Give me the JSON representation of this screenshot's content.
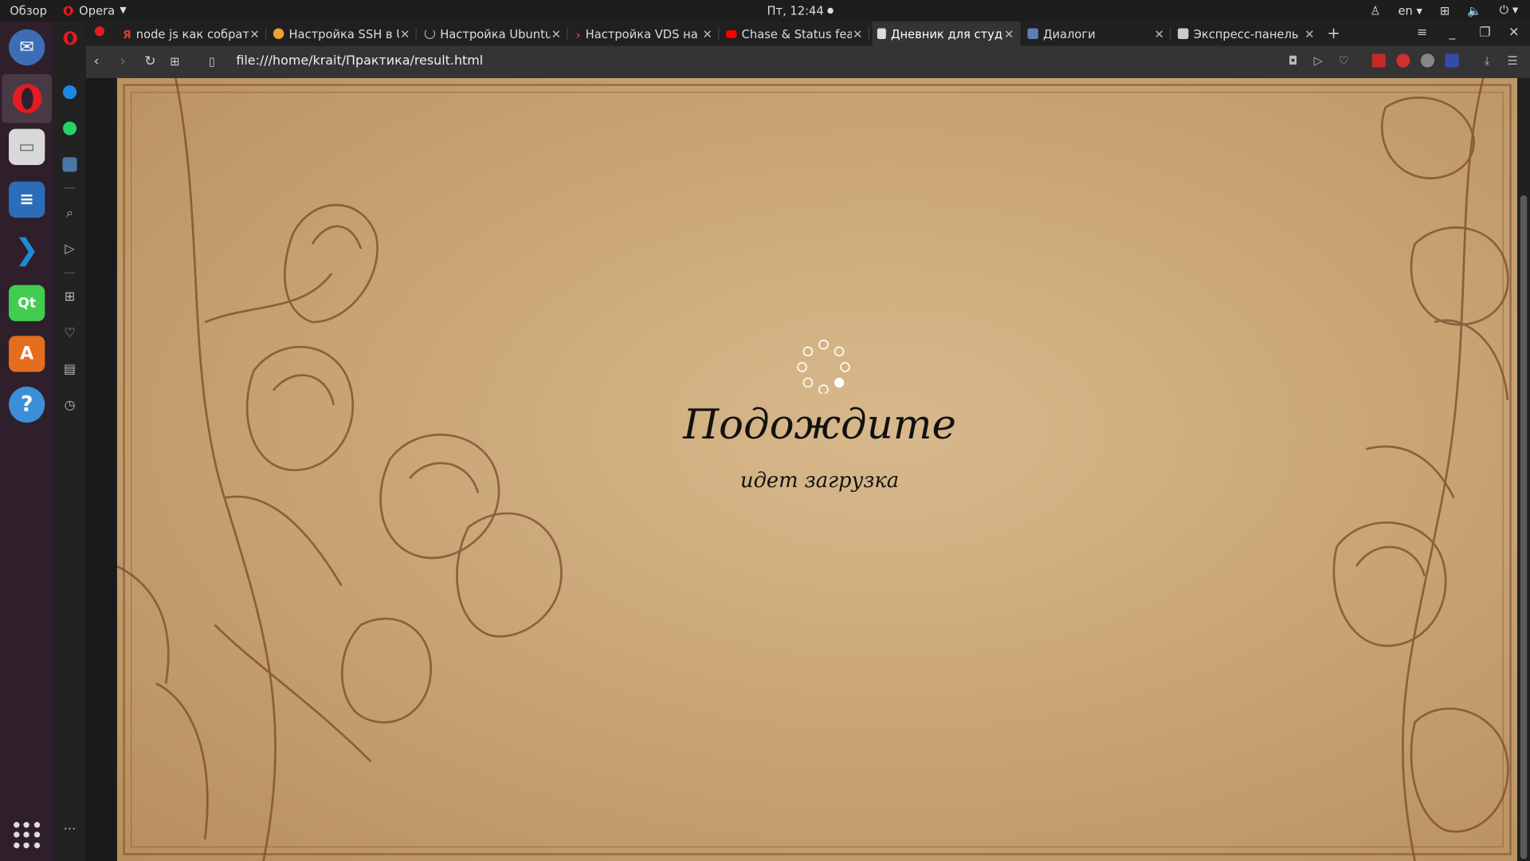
{
  "system": {
    "overview": "Обзор",
    "app_name": "Opera",
    "clock": "Пт, 12:44",
    "lang": "en"
  },
  "tabs": [
    {
      "title": "node js как собрать",
      "color": "#e53935"
    },
    {
      "title": "Настройка SSH в Ubuntu",
      "color": "#f0a030"
    },
    {
      "title": "Настройка Ubuntu",
      "color": "#888888"
    },
    {
      "title": "Настройка VDS на",
      "color": "#e53935"
    },
    {
      "title": "Chase & Status feat",
      "color": "#ff0000"
    },
    {
      "title": "Дневник для студента",
      "color": "#dddddd"
    },
    {
      "title": "Диалоги",
      "color": "#5b7db8"
    },
    {
      "title": "Экспресс-панель",
      "color": "#cccccc"
    }
  ],
  "address": {
    "url": "file:///home/krait/Практика/result.html"
  },
  "page": {
    "title": "Подождите",
    "subtitle": "идет загрузка"
  },
  "colors": {
    "opera_red": "#e31b23",
    "vk_blue": "#4a76a8",
    "whatsapp_green": "#25d366"
  }
}
